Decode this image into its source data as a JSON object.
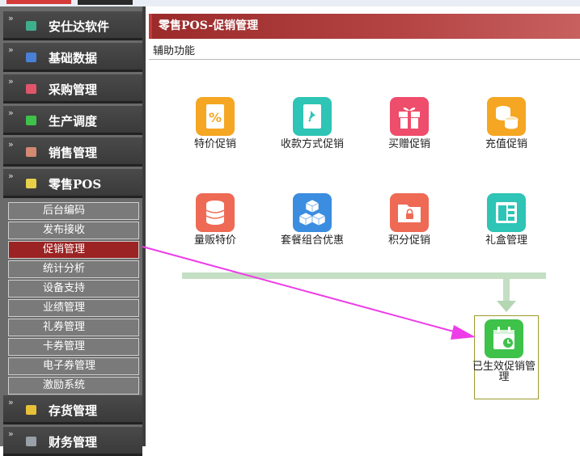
{
  "sidebar": {
    "menus": [
      {
        "label": "安仕达软件",
        "icon": "app-icon",
        "color": "#3fae8c"
      },
      {
        "label": "基础数据",
        "icon": "database-icon",
        "color": "#4a7fd6"
      },
      {
        "label": "采购管理",
        "icon": "purchase-icon",
        "color": "#e0556a"
      },
      {
        "label": "生产调度",
        "icon": "production-icon",
        "color": "#3ec24a"
      },
      {
        "label": "销售管理",
        "icon": "sales-icon",
        "color": "#d38a70"
      },
      {
        "label": "零售POS",
        "icon": "pos-icon",
        "color": "#e7d04a"
      },
      {
        "label": "存货管理",
        "icon": "inventory-icon",
        "color": "#e7c03a"
      },
      {
        "label": "财务管理",
        "icon": "finance-icon",
        "color": "#9aa0a8"
      }
    ],
    "submenu": [
      "后台编码",
      "发布接收",
      "促销管理",
      "统计分析",
      "设备支持",
      "业绩管理",
      "礼券管理",
      "卡券管理",
      "电子券管理",
      "激励系统"
    ],
    "active_submenu": "促销管理"
  },
  "header": {
    "title": "零售POS-促销管理"
  },
  "toolbar": {
    "label": "辅助功能"
  },
  "tiles": [
    {
      "label": "特价促销",
      "icon": "percent-tag-icon",
      "color": "#f5a623"
    },
    {
      "label": "收款方式促销",
      "icon": "pin-doc-icon",
      "color": "#2ec4b6"
    },
    {
      "label": "买赠促销",
      "icon": "gift-icon",
      "color": "#ee4d6b"
    },
    {
      "label": "充值促销",
      "icon": "coins-icon",
      "color": "#f5a623"
    },
    {
      "label": "量贩特价",
      "icon": "database-stack-icon",
      "color": "#ee6a55"
    },
    {
      "label": "套餐组合优惠",
      "icon": "cubes-icon",
      "color": "#3b8de0"
    },
    {
      "label": "积分促销",
      "icon": "locked-folder-icon",
      "color": "#ee6a55"
    },
    {
      "label": "礼盒管理",
      "icon": "layout-panel-icon",
      "color": "#2ec4b6"
    }
  ],
  "active_tile": {
    "label": "已生效促销管理",
    "icon": "calendar-clock-icon",
    "color": "#3ec24a"
  },
  "annotation": {
    "arrow_color": "#ee3ce8"
  }
}
